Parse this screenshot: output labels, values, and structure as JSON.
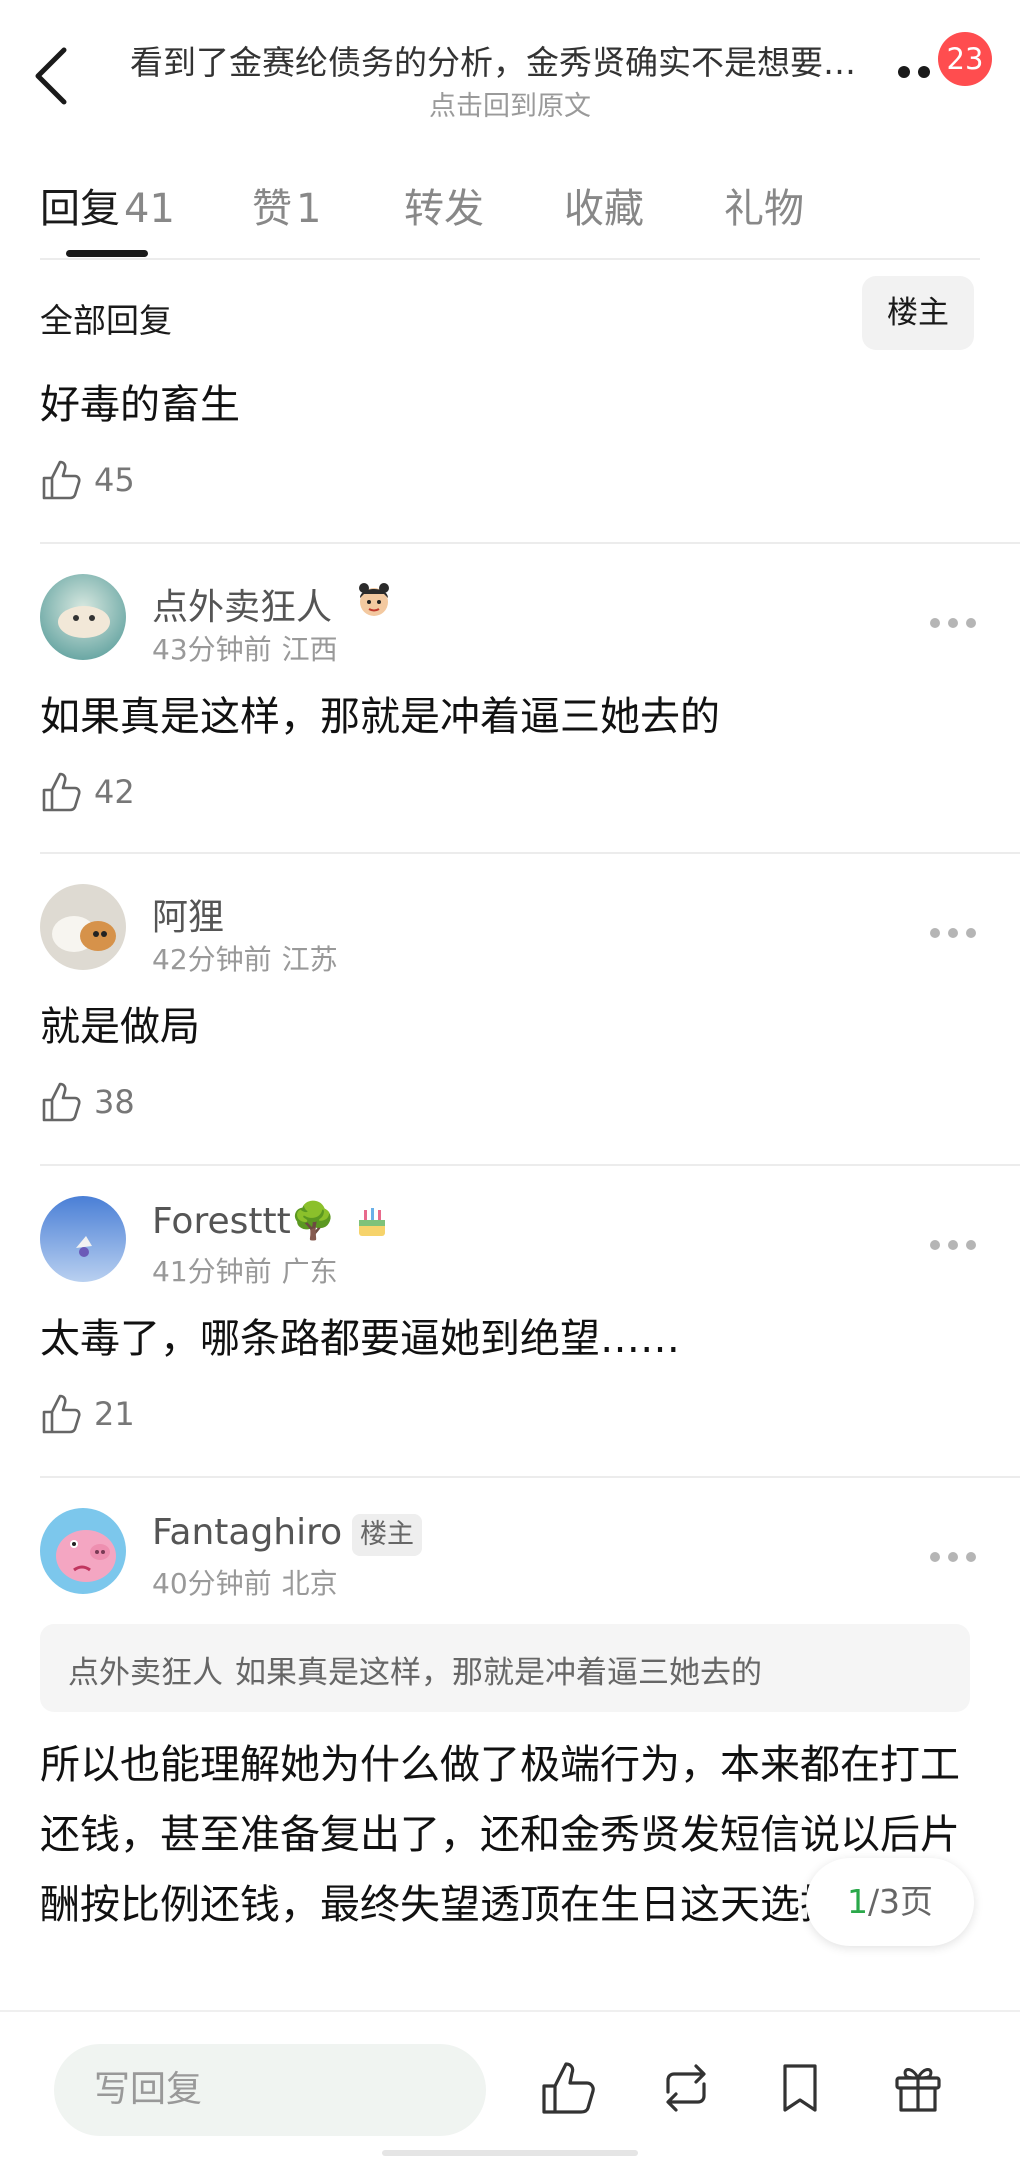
{
  "header": {
    "title": "看到了金赛纶债务的分析，金秀贤确实不是想要…",
    "subtitle": "点击回到原文",
    "notification_count": "23"
  },
  "tabs": [
    {
      "label": "回复",
      "count": "41",
      "active": true
    },
    {
      "label": "赞",
      "count": "1"
    },
    {
      "label": "转发",
      "count": ""
    },
    {
      "label": "收藏",
      "count": ""
    },
    {
      "label": "礼物",
      "count": ""
    }
  ],
  "filter": {
    "label": "全部回复",
    "op_button": "楼主"
  },
  "first_reply": {
    "text": "好毒的畜生",
    "likes": "45"
  },
  "comments": [
    {
      "username": "点外卖狂人",
      "time": "43分钟前",
      "location": "江西",
      "text": "如果真是这样，那就是冲着逼三她去的",
      "likes": "42"
    },
    {
      "username": "阿狸",
      "time": "42分钟前",
      "location": "江苏",
      "text": "就是做局",
      "likes": "38"
    },
    {
      "username": "Foresttt🌳",
      "time": "41分钟前",
      "location": "广东",
      "text": "太毒了，哪条路都要逼她到绝望……",
      "likes": "21"
    },
    {
      "username": "Fantaghiro",
      "op_tag": "楼主",
      "time": "40分钟前",
      "location": "北京",
      "quote_user": "点外卖狂人",
      "quote_text": "如果真是这样，那就是冲着逼三她去的",
      "text": "所以也能理解她为什么做了极端行为，本来都在打工还钱，甚至准备复出了，还和金秀贤发短信说以后片酬按比例还钱，最终失望透顶在生日这天选择自鲨"
    }
  ],
  "pager": {
    "current": "1",
    "total": "/3页"
  },
  "bottom_bar": {
    "reply_placeholder": "写回复"
  },
  "colors": {
    "badge": "#ff4d4f",
    "pager_current": "#2aa84a",
    "input_bg": "#f0f4f1"
  },
  "icons": [
    "back-arrow-icon",
    "more-icon",
    "thumbs-up-icon",
    "repost-icon",
    "bookmark-icon",
    "gift-icon"
  ]
}
